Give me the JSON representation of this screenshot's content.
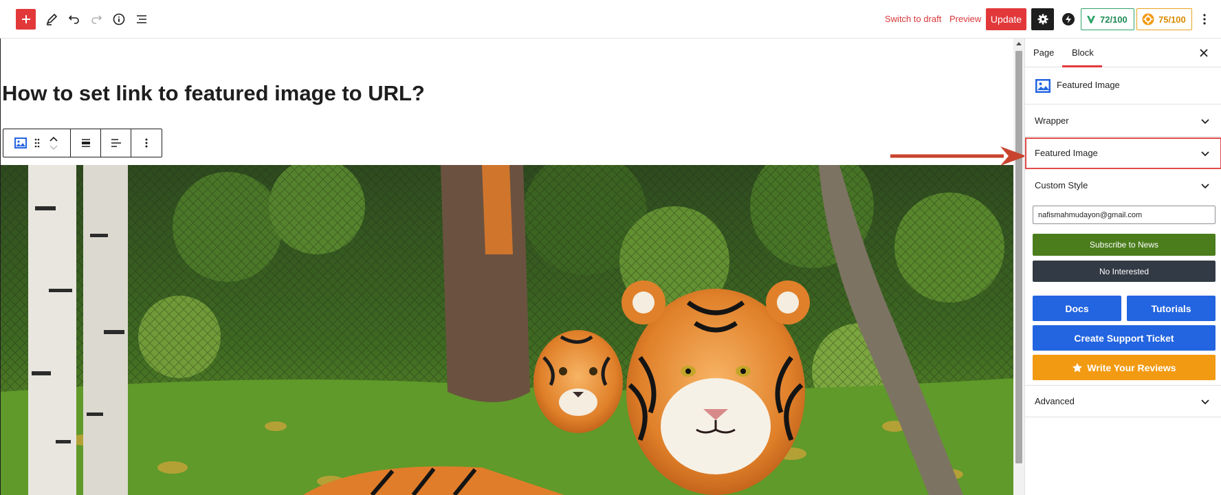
{
  "toolbar": {
    "icons": [
      "plus-icon",
      "pencil-icon",
      "undo-icon",
      "redo-icon",
      "info-icon",
      "list-view-icon"
    ],
    "switch_to_draft": "Switch to draft",
    "preview": "Preview",
    "update": "Update",
    "scores": [
      {
        "label": "72/100",
        "color": "#1f8a55"
      },
      {
        "label": "75/100",
        "color": "#d88a00"
      }
    ]
  },
  "editor": {
    "post_title": "How to set link to featured image to URL?",
    "block_toolbar_icons": [
      "image-icon",
      "drag-handle-icon",
      "move-up-icon",
      "move-down-icon",
      "align-wide-icon",
      "justify-left-icon",
      "more-options-icon"
    ]
  },
  "sidebar": {
    "tabs": [
      {
        "label": "Page",
        "active": false
      },
      {
        "label": "Block",
        "active": true
      }
    ],
    "block_name": "Featured Image",
    "panels": [
      {
        "title": "Wrapper",
        "highlighted": false
      },
      {
        "title": "Featured Image",
        "highlighted": true
      },
      {
        "title": "Custom Style",
        "highlighted": false
      }
    ],
    "email_value": "nafismahmudayon@gmail.com",
    "subscribe_label": "Subscribe to News",
    "not_interested_label": "No Interested",
    "docs_label": "Docs",
    "tutorials_label": "Tutorials",
    "ticket_label": "Create Support Ticket",
    "review_label": "Write Your Reviews",
    "advanced_title": "Advanced"
  },
  "colors": {
    "accent_red": "#e2383a",
    "green": "#4b7d1c",
    "dark": "#323a45",
    "blue": "#2364e0",
    "orange": "#f29a12"
  }
}
